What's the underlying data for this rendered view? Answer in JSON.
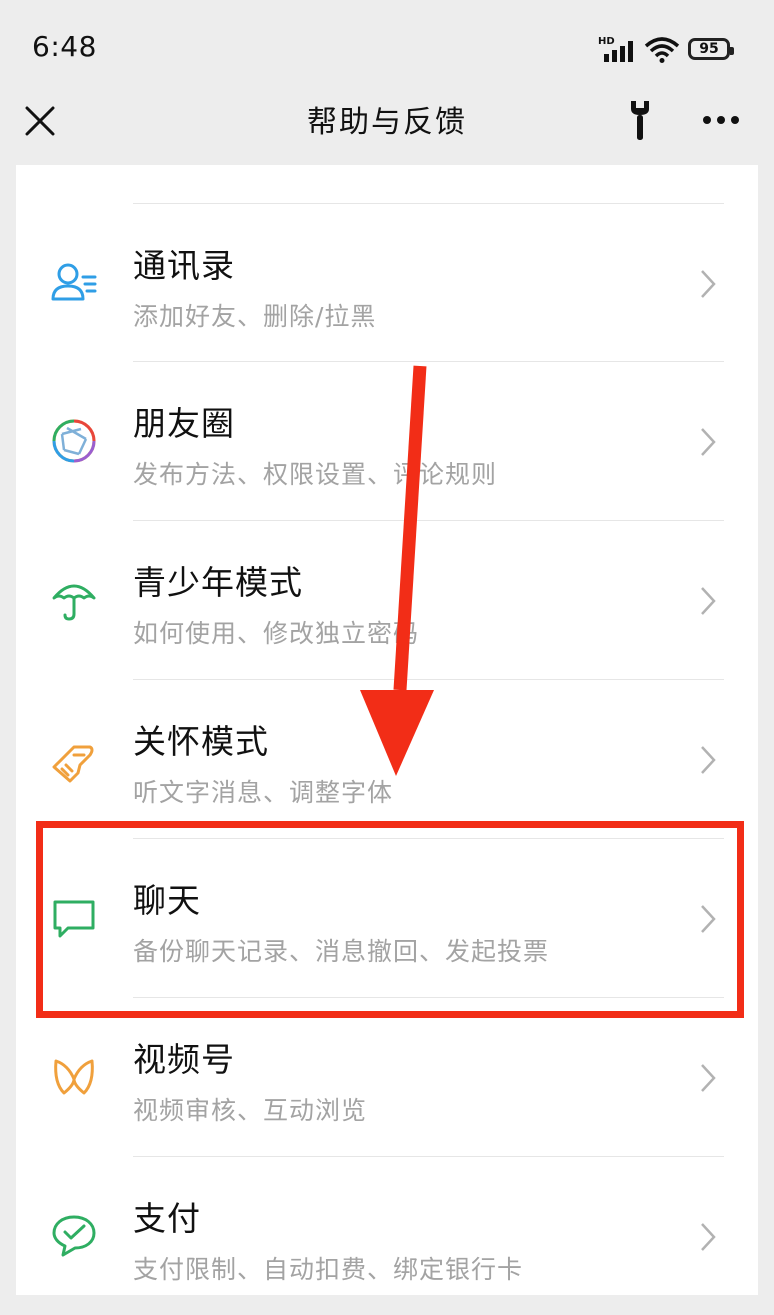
{
  "status_bar": {
    "time": "6:48",
    "network_label": "HD",
    "battery": "95"
  },
  "header": {
    "title": "帮助与反馈",
    "icons": [
      "close-icon",
      "wrench-icon",
      "more-icon"
    ]
  },
  "help_topics": [
    {
      "title": "通讯录",
      "subtitle": "添加好友、删除/拉黑",
      "icon": "contacts-icon",
      "color": "#2f9ee6"
    },
    {
      "title": "朋友圈",
      "subtitle": "发布方法、权限设置、评论规则",
      "icon": "moments-icon",
      "color": "multicolor"
    },
    {
      "title": "青少年模式",
      "subtitle": "如何使用、修改独立密码",
      "icon": "umbrella-icon",
      "color": "#2fae62"
    },
    {
      "title": "关怀模式",
      "subtitle": "听文字消息、调整字体",
      "icon": "care-hand-icon",
      "color": "#f0a03c"
    },
    {
      "title": "聊天",
      "subtitle": "备份聊天记录、消息撤回、发起投票",
      "icon": "chat-bubble-icon",
      "color": "#2fae62"
    },
    {
      "title": "视频号",
      "subtitle": "视频审核、互动浏览",
      "icon": "channels-icon",
      "color": "#f0a03c"
    },
    {
      "title": "支付",
      "subtitle": "支付限制、自动扣费、绑定银行卡",
      "icon": "pay-icon",
      "color": "#2fae62"
    }
  ],
  "annotation": {
    "color": "#f22d17",
    "highlighted_item": "聊天"
  }
}
